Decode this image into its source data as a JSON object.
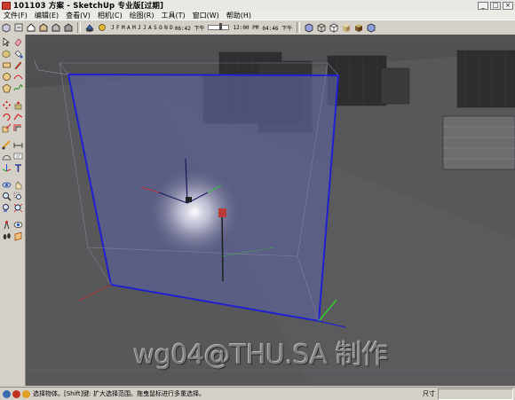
{
  "window": {
    "title": "101103 方案 - SketchUp 专业版[过期]",
    "minimize": "_",
    "maximize": "□",
    "close": "×"
  },
  "menu": [
    "文件(F)",
    "编辑(E)",
    "查看(V)",
    "相机(C)",
    "绘图(R)",
    "工具(T)",
    "窗口(W)",
    "帮助(H)"
  ],
  "shadow_settings": {
    "months": [
      "J",
      "F",
      "M",
      "A",
      "M",
      "J",
      "J",
      "A",
      "S",
      "O",
      "N",
      "D"
    ],
    "sunrise_time": "06:42 下午",
    "noon": "12:00 PM",
    "sunset_time": "04:46 下午"
  },
  "status": {
    "text": "选择物体。[Shift]键: 扩大选择范围。拖曳鼠标进行多重选择。",
    "measure_label": "尺寸",
    "measure_value": ""
  },
  "watermark": "wg04@THU.SA 制作",
  "colors": {
    "viewport_bg": "#4a4a4c",
    "selection_blue": "#2020d0",
    "axis_green": "#2fd02f",
    "axis_red": "#d02020"
  }
}
